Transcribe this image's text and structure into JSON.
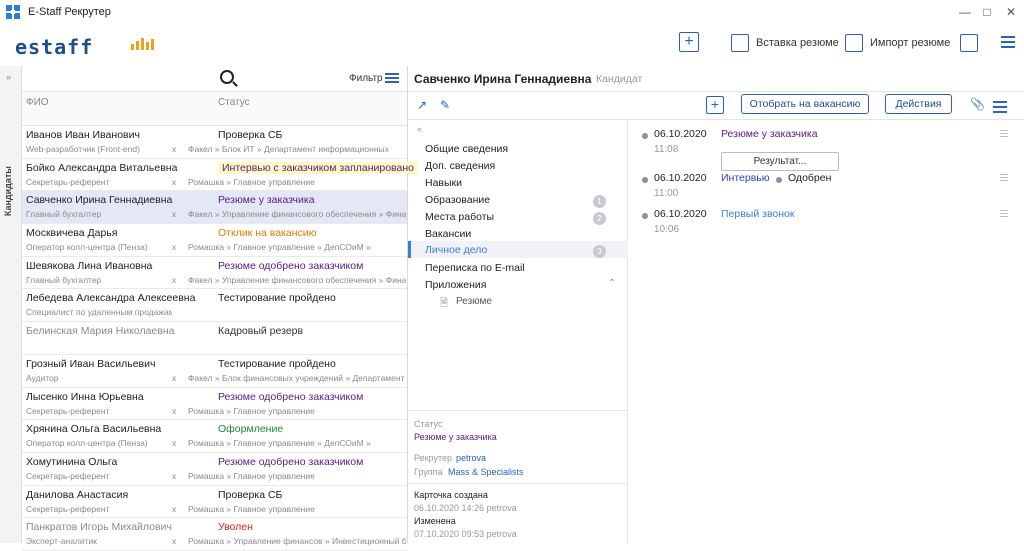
{
  "window": {
    "title": "E-Staff Рекрутер"
  },
  "header": {
    "logo_text": "estaff",
    "paste_resume": "Вставка резюме",
    "import_resume": "Импорт резюме"
  },
  "rail": {
    "label": "Кандидаты"
  },
  "list": {
    "filter_label": "Фильтр",
    "col_name": "ФИО",
    "col_status": "Статус",
    "rows": [
      {
        "name": "Иванов Иван Иванович",
        "status": "Проверка СБ",
        "status_color": "#222222",
        "pos": "Web-разработчик (Front-end)",
        "org": "Факел » Блок ИТ » Департамент информационных",
        "muted": false,
        "hl": false
      },
      {
        "name": "Бойко Александра Витальевна",
        "status": "Интервью с заказчиком запланировано",
        "status_color": "#5a1b84",
        "pos": "Секретарь-референт",
        "org": "Ромашка » Главное управление",
        "muted": false,
        "hl": true
      },
      {
        "name": "Савченко Ирина Геннадиевна",
        "status": "Резюме у заказчика",
        "status_color": "#5a1b84",
        "pos": "Главный бухгалтер",
        "org": "Факел » Управление финансового обеспечения » Финансовый",
        "muted": false,
        "hl": false
      },
      {
        "name": "Москвичева Дарья",
        "status": "Отклик на вакансию",
        "status_color": "#e07b00",
        "pos": "Оператор колл-центра (Пенза)",
        "org": "Ромашка » Главное управление » ДепСОиМ »",
        "muted": false,
        "hl": false
      },
      {
        "name": "Шевякова Лина Ивановна",
        "status": "Резюме одобрено заказчиком",
        "status_color": "#5a1b84",
        "pos": "Главный бухгалтер",
        "org": "Факел » Управление финансового обеспечения » Финансовый",
        "muted": false,
        "hl": false
      },
      {
        "name": "Лебедева Александра Алексеевна",
        "status": "Тестирование пройдено",
        "status_color": "#222222",
        "pos": "Специалист по удаленным продажам XOR Санкт-Петербург",
        "org": "",
        "muted": false,
        "hl": false
      },
      {
        "name": "Белинская Мария Николаевна",
        "status": "Кадровый резерв",
        "status_color": "#333333",
        "pos": "",
        "org": "",
        "muted": true,
        "hl": false
      },
      {
        "name": "Грозный Иван Васильевич",
        "status": "Тестирование пройдено",
        "status_color": "#222222",
        "pos": "Аудитор",
        "org": "Факел » Блок финансовых учреждений » Департамент дочерних банков",
        "muted": false,
        "hl": false
      },
      {
        "name": "Лысенко Инна Юрьевна",
        "status": "Резюме одобрено заказчиком",
        "status_color": "#5a1b84",
        "pos": "Секретарь-референт",
        "org": "Ромашка » Главное управление",
        "muted": false,
        "hl": false
      },
      {
        "name": "Хрянина Ольга Васильевна",
        "status": "Оформление",
        "status_color": "#1e8a3a",
        "pos": "Оператор колл-центра (Пенза)",
        "org": "Ромашка » Главное управление » ДепСОиМ »",
        "muted": false,
        "hl": false
      },
      {
        "name": "Хомутинина Ольга",
        "status": "Резюме одобрено заказчиком",
        "status_color": "#5a1b84",
        "pos": "Секретарь-референт",
        "org": "Ромашка » Главное управление",
        "muted": false,
        "hl": false
      },
      {
        "name": "Данилова Анастасия",
        "status": "Проверка СБ",
        "status_color": "#222222",
        "pos": "Секретарь-референт",
        "org": "Ромашка » Главное управление",
        "muted": false,
        "hl": false
      },
      {
        "name": "Панкратов Игорь Михайлович",
        "status": "Уволен",
        "status_color": "#e02020",
        "pos": "Эксперт-аналитик",
        "org": "Ромашка » Управление финансов » Инвестиционный блок",
        "muted": true,
        "hl": false
      }
    ]
  },
  "detail": {
    "name": "Савченко Ирина Геннадиевна",
    "type": "Кандидат",
    "btn_select_vacancy": "Отобрать на вакансию",
    "btn_actions": "Действия"
  },
  "nav": {
    "items": [
      {
        "label": "Общие сведения",
        "badge": ""
      },
      {
        "label": "Доп. сведения",
        "badge": ""
      },
      {
        "label": "Навыки",
        "badge": ""
      },
      {
        "label": "Образование",
        "badge": "1"
      },
      {
        "label": "Места работы",
        "badge": "2"
      },
      {
        "label": "Вакансии",
        "badge": ""
      },
      {
        "label": "Личное дело",
        "badge": "3"
      },
      {
        "label": "Переписка по E-mail",
        "badge": ""
      },
      {
        "label": "Приложения",
        "badge": ""
      }
    ],
    "attachment": "Резюме"
  },
  "info": {
    "status_label": "Статус",
    "status_value": "Резюме у заказчика",
    "recruiter_label": "Рекрутер",
    "recruiter_value": "petrova",
    "group_label": "Группа",
    "group_value": "Mass & Specialists",
    "created_label": "Карточка создана",
    "created_value": "06.10.2020  14:26  petrova",
    "changed_label": "Изменена",
    "changed_value": "07.10.2020  09:53  petrova"
  },
  "timeline": [
    {
      "date": "06.10.2020",
      "time": "11:08",
      "text": "Резюме у заказчика",
      "color": "#5a1b84",
      "extra": "",
      "button": "Результат..."
    },
    {
      "date": "06.10.2020",
      "time": "11:00",
      "text": "Интервью",
      "color": "#2b3fbf",
      "extra": "Одобрен",
      "button": ""
    },
    {
      "date": "06.10.2020",
      "time": "10:06",
      "text": "Первый звонок",
      "color": "#3b7dd8",
      "extra": "",
      "button": ""
    }
  ]
}
